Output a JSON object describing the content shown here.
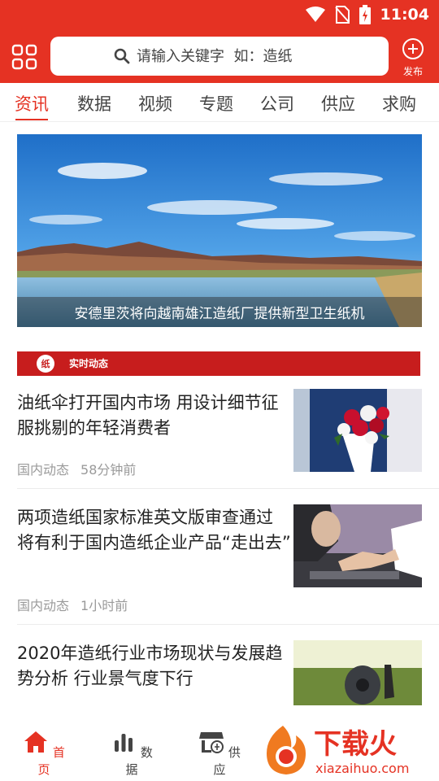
{
  "status_bar": {
    "time": "11:04"
  },
  "header": {
    "search_placeholder": "请输入关键字  如：造纸",
    "publish_label": "发布"
  },
  "tabs": [
    {
      "label": "资讯",
      "active": true
    },
    {
      "label": "数据"
    },
    {
      "label": "视频"
    },
    {
      "label": "专题"
    },
    {
      "label": "公司"
    },
    {
      "label": "供应"
    },
    {
      "label": "求购"
    }
  ],
  "banner": {
    "caption": "安德里茨将向越南雄江造纸厂提供新型卫生纸机"
  },
  "section": {
    "logo_text": "纸",
    "title": "实时动态"
  },
  "news": [
    {
      "title": "油纸伞打开国内市场 用设计细节征服挑剔的年轻消费者",
      "category": "国内动态",
      "time": "58分钟前"
    },
    {
      "title": "两项造纸国家标准英文版审查通过 将有利于国内造纸企业产品“走出去”",
      "category": "国内动态",
      "time": "1小时前"
    },
    {
      "title": "2020年造纸行业市场现状与发展趋势分析 行业景气度下行",
      "category": "",
      "time": ""
    }
  ],
  "bottom_nav": [
    {
      "label": "首页",
      "icon": "home-icon",
      "active": true
    },
    {
      "label": "数据",
      "icon": "bar-chart-icon"
    },
    {
      "label": "供应",
      "icon": "store-icon"
    }
  ],
  "watermark": {
    "brand": "下载火",
    "url": "xiazaihuo.com"
  },
  "colors": {
    "accent": "#e53223",
    "section_bar": "#c71d1d"
  }
}
